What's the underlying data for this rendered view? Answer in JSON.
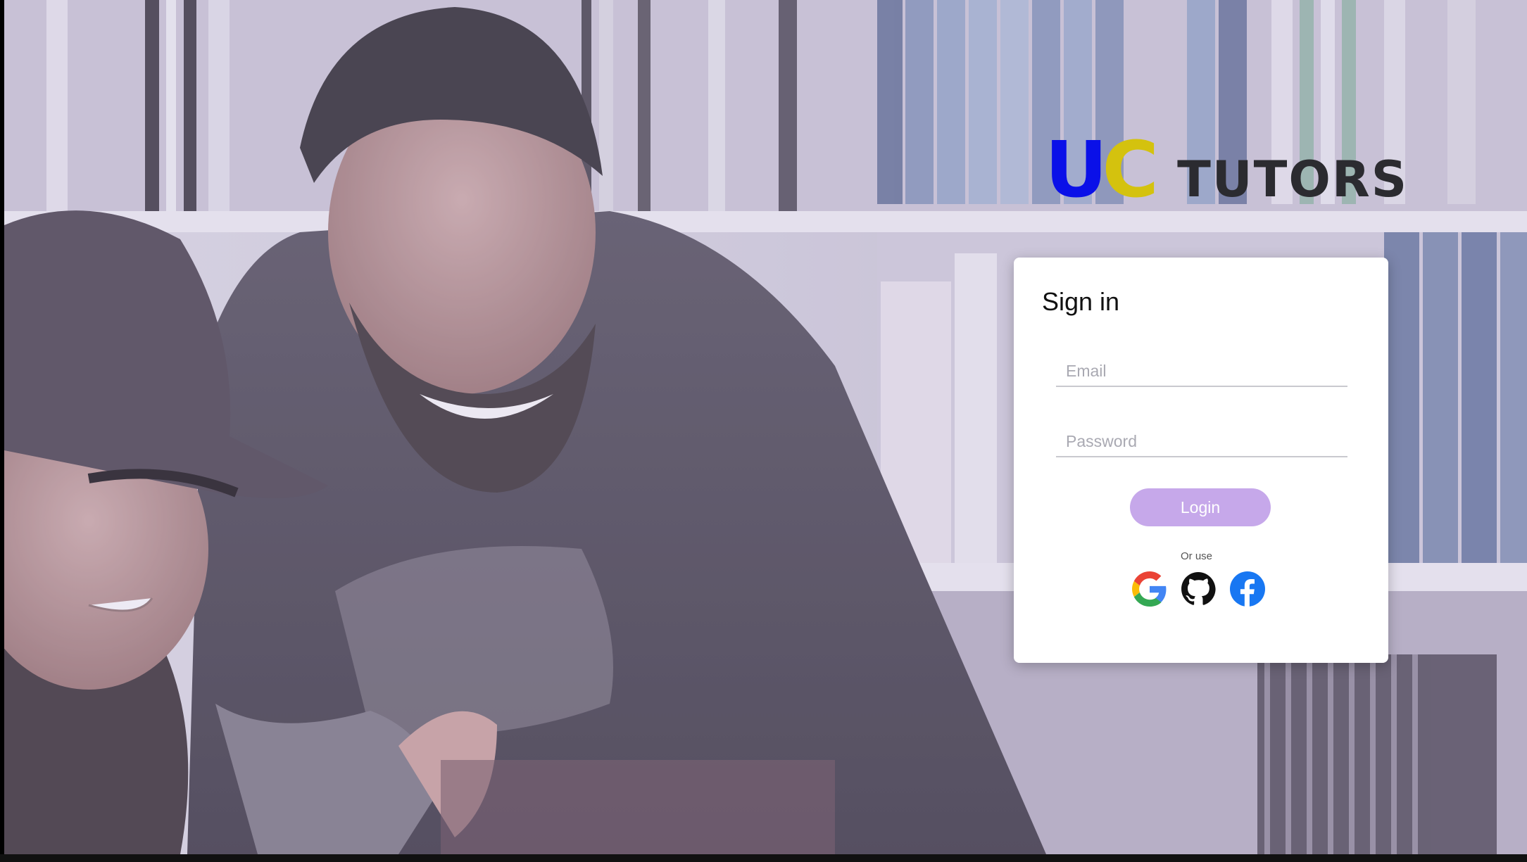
{
  "logo": {
    "u": "U",
    "c": "C",
    "tutors": "TUTORS",
    "u_color": "#0a10e8",
    "c_color": "#d4c20e"
  },
  "signin": {
    "title": "Sign in",
    "email_placeholder": "Email",
    "password_placeholder": "Password",
    "login_label": "Login",
    "or_use": "Or use",
    "login_color": "#c6a8ea"
  },
  "social": [
    "google-icon",
    "github-icon",
    "facebook-icon"
  ],
  "background": "photo of two smiling students in a library"
}
